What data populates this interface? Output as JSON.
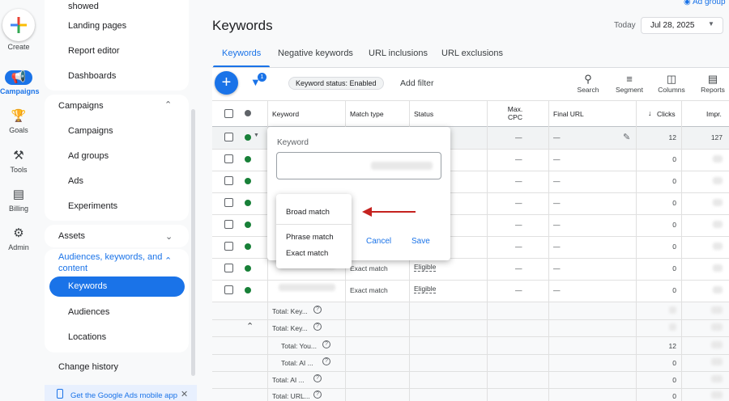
{
  "rail": {
    "create": "Create",
    "items": [
      {
        "label": "Campaigns",
        "icon": "megaphone-icon",
        "active": true
      },
      {
        "label": "Goals",
        "icon": "trophy-icon"
      },
      {
        "label": "Tools",
        "icon": "tools-icon"
      },
      {
        "label": "Billing",
        "icon": "card-icon"
      },
      {
        "label": "Admin",
        "icon": "gear-icon"
      }
    ]
  },
  "nav": {
    "top_items": [
      "showed",
      "Landing pages",
      "Report editor",
      "Dashboards"
    ],
    "campaigns_head": "Campaigns",
    "campaign_items": [
      "Campaigns",
      "Ad groups",
      "Ads",
      "Experiments"
    ],
    "assets_head": "Assets",
    "audiences_head": "Audiences, keywords, and content",
    "audience_items": [
      "Keywords",
      "Audiences",
      "Locations"
    ],
    "change_history": "Change history",
    "mobile_app": "Get the Google Ads mobile app"
  },
  "header": {
    "title": "Keywords",
    "top_right": "Ad group",
    "date_prefix": "Today",
    "date": "Jul 28, 2025"
  },
  "tabs": [
    "Keywords",
    "Negative keywords",
    "URL inclusions",
    "URL exclusions"
  ],
  "toolbar": {
    "filter_badge": "1",
    "status_chip": "Keyword status: Enabled",
    "add_filter": "Add filter",
    "tools": [
      {
        "label": "Search",
        "icon": "search-icon"
      },
      {
        "label": "Segment",
        "icon": "segment-icon"
      },
      {
        "label": "Columns",
        "icon": "columns-icon"
      },
      {
        "label": "Reports",
        "icon": "reports-icon"
      }
    ]
  },
  "table": {
    "headers": {
      "keyword": "Keyword",
      "match_type": "Match type",
      "status": "Status",
      "max_cpc": "Max. CPC",
      "final_url": "Final URL",
      "clicks": "Clicks",
      "impr": "Impr."
    },
    "rows": [
      {
        "max_cpc": "—",
        "final_url": "—",
        "clicks": "12",
        "impr": "127"
      },
      {
        "max_cpc": "—",
        "final_url": "—",
        "clicks": "0"
      },
      {
        "max_cpc": "—",
        "final_url": "—",
        "clicks": "0"
      },
      {
        "max_cpc": "—",
        "final_url": "—",
        "clicks": "0"
      },
      {
        "max_cpc": "—",
        "final_url": "—",
        "clicks": "0"
      },
      {
        "max_cpc": "—",
        "final_url": "—",
        "clicks": "0"
      },
      {
        "match": "Exact match",
        "status": "Eligible",
        "max_cpc": "—",
        "final_url": "—",
        "clicks": "0"
      },
      {
        "match": "Exact match",
        "status": "Eligible",
        "max_cpc": "—",
        "final_url": "—",
        "clicks": "0"
      }
    ],
    "totals": [
      {
        "label": "Total: Key...",
        "clicks": ""
      },
      {
        "label": "Total: Key...",
        "clicks": ""
      },
      {
        "label": "Total: You...",
        "clicks": "12"
      },
      {
        "label": "Total: AI ...",
        "clicks": "0"
      },
      {
        "label": "Total: AI ...",
        "clicks": "0"
      },
      {
        "label": "Total: URL...",
        "clicks": "0"
      }
    ]
  },
  "popup": {
    "label": "Keyword",
    "cancel": "Cancel",
    "save": "Save",
    "options": [
      "Broad match",
      "Phrase match",
      "Exact match"
    ]
  },
  "colors": {
    "accent": "#1a73e8",
    "arrow": "#c5221f",
    "enabled": "#188038"
  }
}
